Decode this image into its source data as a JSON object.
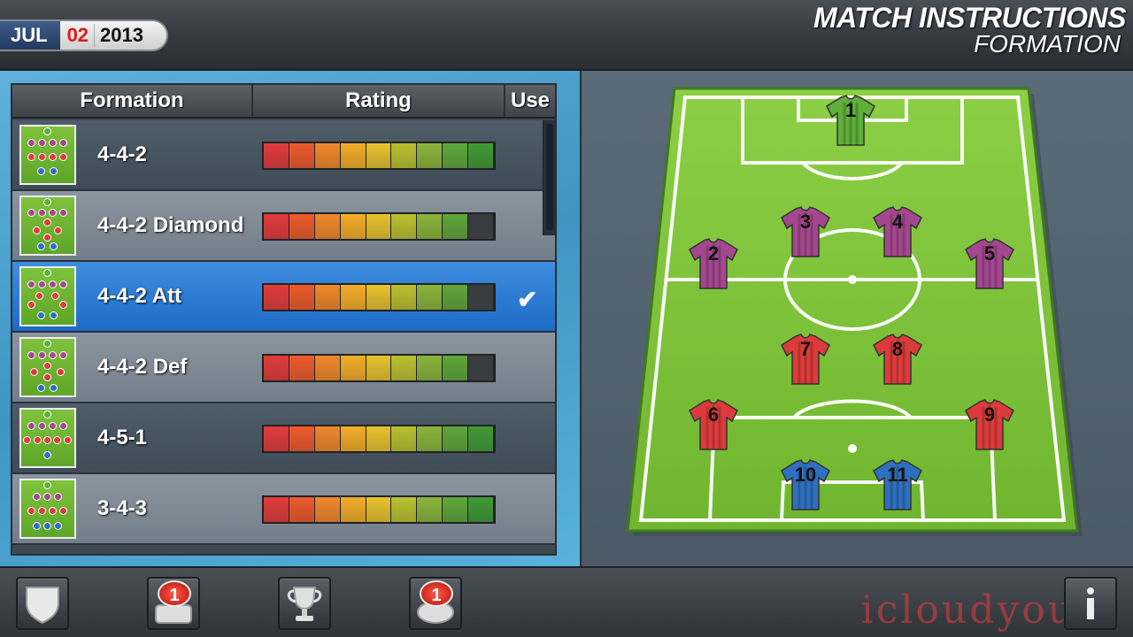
{
  "date": {
    "month": "JUL",
    "day": "02",
    "year": "2013"
  },
  "header": {
    "title": "MATCH INSTRUCTIONS",
    "subtitle": "FORMATION"
  },
  "table": {
    "columns": {
      "formation": "Formation",
      "rating": "Rating",
      "use": "Use"
    },
    "rows": [
      {
        "name": "4-4-2",
        "rating_filled": 9,
        "selected": false,
        "style": "dark"
      },
      {
        "name": "4-4-2 Diamond",
        "rating_filled": 8,
        "selected": false,
        "style": "light"
      },
      {
        "name": "4-4-2 Att",
        "rating_filled": 8,
        "selected": true,
        "style": "selected"
      },
      {
        "name": "4-4-2 Def",
        "rating_filled": 8,
        "selected": false,
        "style": "light"
      },
      {
        "name": "4-5-1",
        "rating_filled": 9,
        "selected": false,
        "style": "dark"
      },
      {
        "name": "3-4-3",
        "rating_filled": 9,
        "selected": false,
        "style": "light"
      }
    ],
    "rating_segments": 9,
    "check_icon": "checkmark-icon"
  },
  "players": [
    {
      "number": "1",
      "color": "#5fae3a"
    },
    {
      "number": "2",
      "color": "#a4478e"
    },
    {
      "number": "3",
      "color": "#a4478e"
    },
    {
      "number": "4",
      "color": "#a4478e"
    },
    {
      "number": "5",
      "color": "#a4478e"
    },
    {
      "number": "6",
      "color": "#dd3b3b"
    },
    {
      "number": "7",
      "color": "#dd3b3b"
    },
    {
      "number": "8",
      "color": "#dd3b3b"
    },
    {
      "number": "9",
      "color": "#dd3b3b"
    },
    {
      "number": "10",
      "color": "#2f6fbf"
    },
    {
      "number": "11",
      "color": "#2f6fbf"
    }
  ],
  "bottom_bar": {
    "buttons": [
      {
        "icon": "shield-icon",
        "badge": ""
      },
      {
        "icon": "inbox-icon",
        "badge": "1"
      },
      {
        "icon": "trophy-icon",
        "badge": ""
      },
      {
        "icon": "whistle-icon",
        "badge": "1"
      },
      {
        "icon": "info-icon",
        "badge": ""
      }
    ]
  },
  "watermark": "icloudyouxi",
  "colors": {
    "selected_row": "#1d6bc6",
    "pitch": "#7cc23a"
  }
}
